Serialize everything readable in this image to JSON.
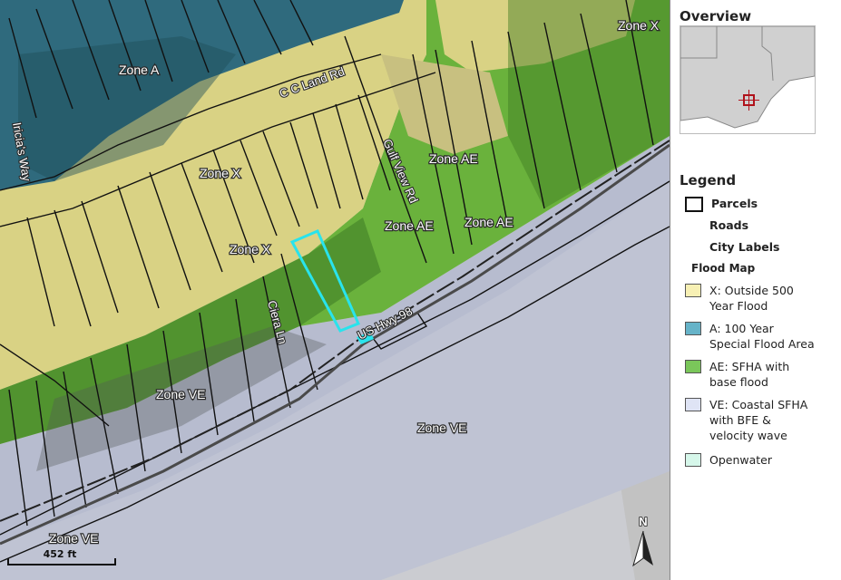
{
  "map": {
    "zone_labels": [
      "Zone X",
      "Zone A",
      "Zone X",
      "Zone AE",
      "Zone X",
      "Zone AE",
      "Zone AE",
      "Zone VE",
      "Zone VE",
      "Zone VE"
    ],
    "road_labels": [
      "C C Land Rd",
      "Iricia's Way",
      "Gulf View Rd",
      "US Hwy 98",
      "Ciera Ln"
    ],
    "scale_label": "452 ft",
    "north_label": "N",
    "selected_parcel_color": "#29e3ec",
    "zone_colors": {
      "X": "#e1d886",
      "A": "#3a7f93",
      "AE": "#6ab83a",
      "VE": "#c3c8df",
      "Openwater": "#d8f5e9"
    }
  },
  "panel": {
    "overview_title": "Overview",
    "legend_title": "Legend",
    "items": {
      "parcels": "Parcels",
      "roads": "Roads",
      "city_labels": "City Labels",
      "flood_map": "Flood Map",
      "zone_x": "X: Outside 500 Year Flood",
      "zone_a": "A: 100 Year Special Flood Area",
      "zone_ae": "AE: SFHA with base flood elevation BFE",
      "zone_ve": "VE: Coastal SFHA with BFE & velocity wave action",
      "openwater": "Openwater"
    },
    "colors": {
      "zone_x": "#f7f0b4",
      "zone_a": "#66b3c8",
      "zone_ae": "#7ac65a",
      "zone_ve": "#dfe4f5",
      "openwater": "#d6f7ea"
    }
  }
}
